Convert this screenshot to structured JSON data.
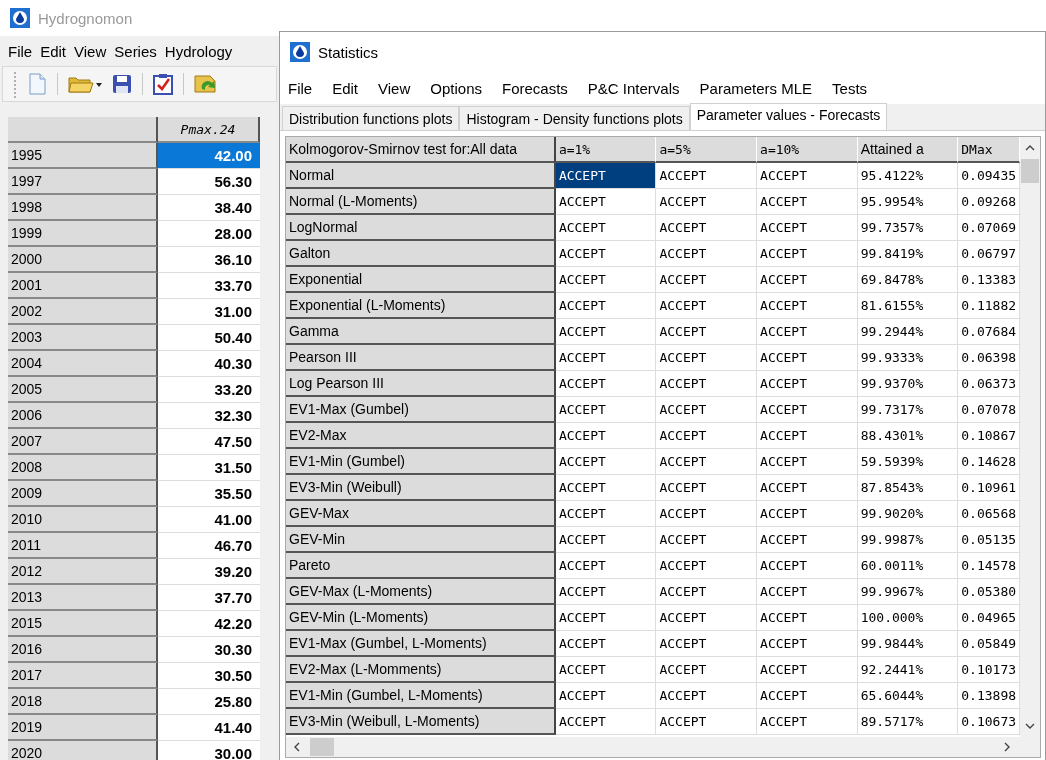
{
  "main_window": {
    "title": "Hydrognomon",
    "active": false,
    "menu": [
      "File",
      "Edit",
      "View",
      "Series",
      "Hydrology"
    ],
    "grid": {
      "column": "Pmax.24",
      "rows": [
        {
          "year": "1995",
          "value": "42.00",
          "selected": true
        },
        {
          "year": "1997",
          "value": "56.30",
          "selected": false
        },
        {
          "year": "1998",
          "value": "38.40",
          "selected": false
        },
        {
          "year": "1999",
          "value": "28.00",
          "selected": false
        },
        {
          "year": "2000",
          "value": "36.10",
          "selected": false
        },
        {
          "year": "2001",
          "value": "33.70",
          "selected": false
        },
        {
          "year": "2002",
          "value": "31.00",
          "selected": false
        },
        {
          "year": "2003",
          "value": "50.40",
          "selected": false
        },
        {
          "year": "2004",
          "value": "40.30",
          "selected": false
        },
        {
          "year": "2005",
          "value": "33.20",
          "selected": false
        },
        {
          "year": "2006",
          "value": "32.30",
          "selected": false
        },
        {
          "year": "2007",
          "value": "47.50",
          "selected": false
        },
        {
          "year": "2008",
          "value": "31.50",
          "selected": false
        },
        {
          "year": "2009",
          "value": "35.50",
          "selected": false
        },
        {
          "year": "2010",
          "value": "41.00",
          "selected": false
        },
        {
          "year": "2011",
          "value": "46.70",
          "selected": false
        },
        {
          "year": "2012",
          "value": "39.20",
          "selected": false
        },
        {
          "year": "2013",
          "value": "37.70",
          "selected": false
        },
        {
          "year": "2015",
          "value": "42.20",
          "selected": false
        },
        {
          "year": "2016",
          "value": "30.30",
          "selected": false
        },
        {
          "year": "2017",
          "value": "30.50",
          "selected": false
        },
        {
          "year": "2018",
          "value": "25.80",
          "selected": false
        },
        {
          "year": "2019",
          "value": "41.40",
          "selected": false
        },
        {
          "year": "2020",
          "value": "30.00",
          "selected": false
        }
      ]
    }
  },
  "statistics_window": {
    "title": "Statistics",
    "active": true,
    "menu": [
      "File",
      "Edit",
      "View",
      "Options",
      "Forecasts",
      "P&C Intervals",
      "Parameters MLE",
      "Tests"
    ],
    "tabs": [
      {
        "label": "Distribution functions plots",
        "selected": false
      },
      {
        "label": "Histogram - Density functions plots",
        "selected": false
      },
      {
        "label": "Parameter values - Forecasts",
        "selected": true
      }
    ],
    "table": {
      "row_header_title": "Kolmogorov-Smirnov test for:All data",
      "columns": [
        "a=1%",
        "a=5%",
        "a=10%",
        "Attained a",
        "DMax"
      ],
      "rows": [
        {
          "name": "Normal",
          "cells": [
            {
              "text": "ACCEPT",
              "selected": true
            },
            {
              "text": "ACCEPT",
              "selected": false
            },
            {
              "text": "ACCEPT",
              "selected": false
            },
            {
              "text": "95.4122%",
              "selected": false
            },
            {
              "text": "0.09435",
              "selected": false
            }
          ]
        },
        {
          "name": "Normal (L-Moments)",
          "cells": [
            {
              "text": "ACCEPT",
              "selected": false
            },
            {
              "text": "ACCEPT",
              "selected": false
            },
            {
              "text": "ACCEPT",
              "selected": false
            },
            {
              "text": "95.9954%",
              "selected": false
            },
            {
              "text": "0.09268",
              "selected": false
            }
          ]
        },
        {
          "name": "LogNormal",
          "cells": [
            {
              "text": "ACCEPT",
              "selected": false
            },
            {
              "text": "ACCEPT",
              "selected": false
            },
            {
              "text": "ACCEPT",
              "selected": false
            },
            {
              "text": "99.7357%",
              "selected": false
            },
            {
              "text": "0.07069",
              "selected": false
            }
          ]
        },
        {
          "name": "Galton",
          "cells": [
            {
              "text": "ACCEPT",
              "selected": false
            },
            {
              "text": "ACCEPT",
              "selected": false
            },
            {
              "text": "ACCEPT",
              "selected": false
            },
            {
              "text": "99.8419%",
              "selected": false
            },
            {
              "text": "0.06797",
              "selected": false
            }
          ]
        },
        {
          "name": "Exponential",
          "cells": [
            {
              "text": "ACCEPT",
              "selected": false
            },
            {
              "text": "ACCEPT",
              "selected": false
            },
            {
              "text": "ACCEPT",
              "selected": false
            },
            {
              "text": "69.8478%",
              "selected": false
            },
            {
              "text": "0.13383",
              "selected": false
            }
          ]
        },
        {
          "name": "Exponential (L-Moments)",
          "cells": [
            {
              "text": "ACCEPT",
              "selected": false
            },
            {
              "text": "ACCEPT",
              "selected": false
            },
            {
              "text": "ACCEPT",
              "selected": false
            },
            {
              "text": "81.6155%",
              "selected": false
            },
            {
              "text": "0.11882",
              "selected": false
            }
          ]
        },
        {
          "name": "Gamma",
          "cells": [
            {
              "text": "ACCEPT",
              "selected": false
            },
            {
              "text": "ACCEPT",
              "selected": false
            },
            {
              "text": "ACCEPT",
              "selected": false
            },
            {
              "text": "99.2944%",
              "selected": false
            },
            {
              "text": "0.07684",
              "selected": false
            }
          ]
        },
        {
          "name": "Pearson III",
          "cells": [
            {
              "text": "ACCEPT",
              "selected": false
            },
            {
              "text": "ACCEPT",
              "selected": false
            },
            {
              "text": "ACCEPT",
              "selected": false
            },
            {
              "text": "99.9333%",
              "selected": false
            },
            {
              "text": "0.06398",
              "selected": false
            }
          ]
        },
        {
          "name": "Log Pearson III",
          "cells": [
            {
              "text": "ACCEPT",
              "selected": false
            },
            {
              "text": "ACCEPT",
              "selected": false
            },
            {
              "text": "ACCEPT",
              "selected": false
            },
            {
              "text": "99.9370%",
              "selected": false
            },
            {
              "text": "0.06373",
              "selected": false
            }
          ]
        },
        {
          "name": "EV1-Max (Gumbel)",
          "cells": [
            {
              "text": "ACCEPT",
              "selected": false
            },
            {
              "text": "ACCEPT",
              "selected": false
            },
            {
              "text": "ACCEPT",
              "selected": false
            },
            {
              "text": "99.7317%",
              "selected": false
            },
            {
              "text": "0.07078",
              "selected": false
            }
          ]
        },
        {
          "name": "EV2-Max",
          "cells": [
            {
              "text": "ACCEPT",
              "selected": false
            },
            {
              "text": "ACCEPT",
              "selected": false
            },
            {
              "text": "ACCEPT",
              "selected": false
            },
            {
              "text": "88.4301%",
              "selected": false
            },
            {
              "text": "0.10867",
              "selected": false
            }
          ]
        },
        {
          "name": "EV1-Min (Gumbel)",
          "cells": [
            {
              "text": "ACCEPT",
              "selected": false
            },
            {
              "text": "ACCEPT",
              "selected": false
            },
            {
              "text": "ACCEPT",
              "selected": false
            },
            {
              "text": "59.5939%",
              "selected": false
            },
            {
              "text": "0.14628",
              "selected": false
            }
          ]
        },
        {
          "name": "EV3-Min (Weibull)",
          "cells": [
            {
              "text": "ACCEPT",
              "selected": false
            },
            {
              "text": "ACCEPT",
              "selected": false
            },
            {
              "text": "ACCEPT",
              "selected": false
            },
            {
              "text": "87.8543%",
              "selected": false
            },
            {
              "text": "0.10961",
              "selected": false
            }
          ]
        },
        {
          "name": "GEV-Max",
          "cells": [
            {
              "text": "ACCEPT",
              "selected": false
            },
            {
              "text": "ACCEPT",
              "selected": false
            },
            {
              "text": "ACCEPT",
              "selected": false
            },
            {
              "text": "99.9020%",
              "selected": false
            },
            {
              "text": "0.06568",
              "selected": false
            }
          ]
        },
        {
          "name": "GEV-Min",
          "cells": [
            {
              "text": "ACCEPT",
              "selected": false
            },
            {
              "text": "ACCEPT",
              "selected": false
            },
            {
              "text": "ACCEPT",
              "selected": false
            },
            {
              "text": "99.9987%",
              "selected": false
            },
            {
              "text": "0.05135",
              "selected": false
            }
          ]
        },
        {
          "name": "Pareto",
          "cells": [
            {
              "text": "ACCEPT",
              "selected": false
            },
            {
              "text": "ACCEPT",
              "selected": false
            },
            {
              "text": "ACCEPT",
              "selected": false
            },
            {
              "text": "60.0011%",
              "selected": false
            },
            {
              "text": "0.14578",
              "selected": false
            }
          ]
        },
        {
          "name": "GEV-Max (L-Moments)",
          "cells": [
            {
              "text": "ACCEPT",
              "selected": false
            },
            {
              "text": "ACCEPT",
              "selected": false
            },
            {
              "text": "ACCEPT",
              "selected": false
            },
            {
              "text": "99.9967%",
              "selected": false
            },
            {
              "text": "0.05380",
              "selected": false
            }
          ]
        },
        {
          "name": "GEV-Min (L-Moments)",
          "cells": [
            {
              "text": "ACCEPT",
              "selected": false
            },
            {
              "text": "ACCEPT",
              "selected": false
            },
            {
              "text": "ACCEPT",
              "selected": false
            },
            {
              "text": "100.000%",
              "selected": false
            },
            {
              "text": "0.04965",
              "selected": false
            }
          ]
        },
        {
          "name": "EV1-Max (Gumbel, L-Moments)",
          "cells": [
            {
              "text": "ACCEPT",
              "selected": false
            },
            {
              "text": "ACCEPT",
              "selected": false
            },
            {
              "text": "ACCEPT",
              "selected": false
            },
            {
              "text": "99.9844%",
              "selected": false
            },
            {
              "text": "0.05849",
              "selected": false
            }
          ]
        },
        {
          "name": "EV2-Max (L-Momments)",
          "cells": [
            {
              "text": "ACCEPT",
              "selected": false
            },
            {
              "text": "ACCEPT",
              "selected": false
            },
            {
              "text": "ACCEPT",
              "selected": false
            },
            {
              "text": "92.2441%",
              "selected": false
            },
            {
              "text": "0.10173",
              "selected": false
            }
          ]
        },
        {
          "name": "EV1-Min (Gumbel, L-Moments)",
          "cells": [
            {
              "text": "ACCEPT",
              "selected": false
            },
            {
              "text": "ACCEPT",
              "selected": false
            },
            {
              "text": "ACCEPT",
              "selected": false
            },
            {
              "text": "65.6044%",
              "selected": false
            },
            {
              "text": "0.13898",
              "selected": false
            }
          ]
        },
        {
          "name": "EV3-Min (Weibull, L-Moments)",
          "cells": [
            {
              "text": "ACCEPT",
              "selected": false
            },
            {
              "text": "ACCEPT",
              "selected": false
            },
            {
              "text": "ACCEPT",
              "selected": false
            },
            {
              "text": "89.5717%",
              "selected": false
            },
            {
              "text": "0.10673",
              "selected": false
            }
          ]
        }
      ]
    }
  }
}
